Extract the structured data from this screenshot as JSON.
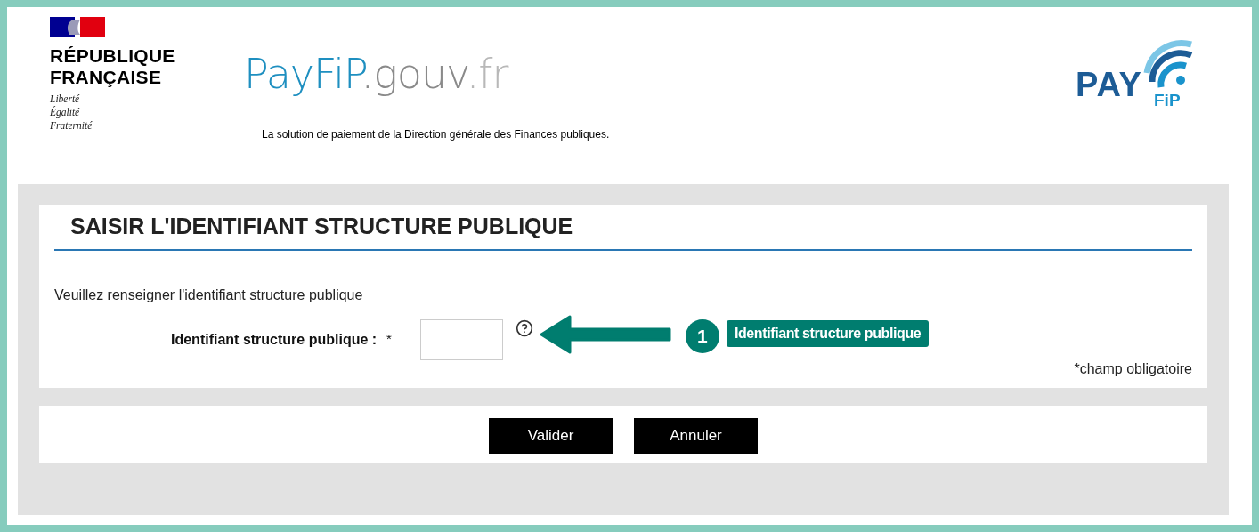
{
  "header": {
    "republic": [
      "RÉPUBLIQUE",
      "FRANÇAISE"
    ],
    "motto": [
      "Liberté",
      "Égalité",
      "Fraternité"
    ],
    "site_name": {
      "brand": "PayFiP",
      "domain": ".gouv",
      "tld": ".fr"
    },
    "tagline": "La solution de paiement de la Direction générale des Finances publiques.",
    "badge_logo": {
      "main": "PAY",
      "sub": "FiP"
    }
  },
  "form": {
    "title": "SAISIR L'IDENTIFIANT STRUCTURE PUBLIQUE",
    "intro": "Veuillez renseigner l'identifiant structure publique",
    "field": {
      "label": "Identifiant structure publique :",
      "required_mark": "*"
    },
    "required_note": "*champ obligatoire"
  },
  "annotation": {
    "number": "1",
    "label": "Identifiant structure publique"
  },
  "buttons": [
    {
      "label": "Valider"
    },
    {
      "label": "Annuler"
    }
  ]
}
